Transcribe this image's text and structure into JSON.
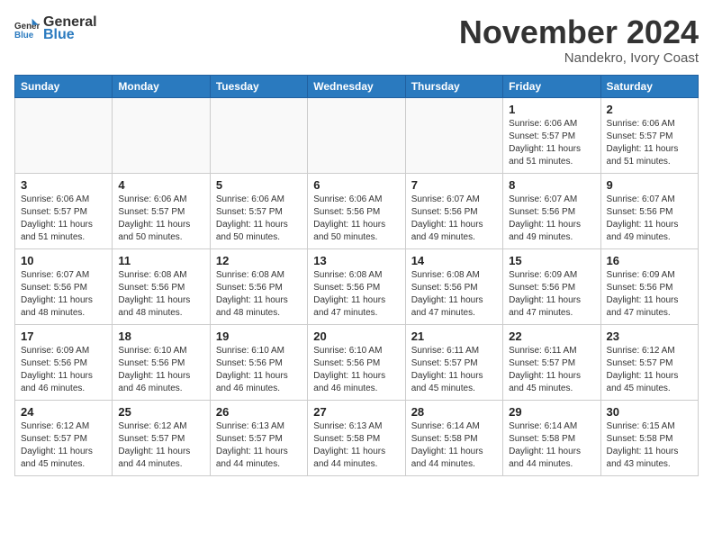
{
  "header": {
    "logo_line1": "General",
    "logo_line2": "Blue",
    "month_title": "November 2024",
    "location": "Nandekro, Ivory Coast"
  },
  "weekdays": [
    "Sunday",
    "Monday",
    "Tuesday",
    "Wednesday",
    "Thursday",
    "Friday",
    "Saturday"
  ],
  "weeks": [
    [
      {
        "day": "",
        "info": ""
      },
      {
        "day": "",
        "info": ""
      },
      {
        "day": "",
        "info": ""
      },
      {
        "day": "",
        "info": ""
      },
      {
        "day": "",
        "info": ""
      },
      {
        "day": "1",
        "info": "Sunrise: 6:06 AM\nSunset: 5:57 PM\nDaylight: 11 hours\nand 51 minutes."
      },
      {
        "day": "2",
        "info": "Sunrise: 6:06 AM\nSunset: 5:57 PM\nDaylight: 11 hours\nand 51 minutes."
      }
    ],
    [
      {
        "day": "3",
        "info": "Sunrise: 6:06 AM\nSunset: 5:57 PM\nDaylight: 11 hours\nand 51 minutes."
      },
      {
        "day": "4",
        "info": "Sunrise: 6:06 AM\nSunset: 5:57 PM\nDaylight: 11 hours\nand 50 minutes."
      },
      {
        "day": "5",
        "info": "Sunrise: 6:06 AM\nSunset: 5:57 PM\nDaylight: 11 hours\nand 50 minutes."
      },
      {
        "day": "6",
        "info": "Sunrise: 6:06 AM\nSunset: 5:56 PM\nDaylight: 11 hours\nand 50 minutes."
      },
      {
        "day": "7",
        "info": "Sunrise: 6:07 AM\nSunset: 5:56 PM\nDaylight: 11 hours\nand 49 minutes."
      },
      {
        "day": "8",
        "info": "Sunrise: 6:07 AM\nSunset: 5:56 PM\nDaylight: 11 hours\nand 49 minutes."
      },
      {
        "day": "9",
        "info": "Sunrise: 6:07 AM\nSunset: 5:56 PM\nDaylight: 11 hours\nand 49 minutes."
      }
    ],
    [
      {
        "day": "10",
        "info": "Sunrise: 6:07 AM\nSunset: 5:56 PM\nDaylight: 11 hours\nand 48 minutes."
      },
      {
        "day": "11",
        "info": "Sunrise: 6:08 AM\nSunset: 5:56 PM\nDaylight: 11 hours\nand 48 minutes."
      },
      {
        "day": "12",
        "info": "Sunrise: 6:08 AM\nSunset: 5:56 PM\nDaylight: 11 hours\nand 48 minutes."
      },
      {
        "day": "13",
        "info": "Sunrise: 6:08 AM\nSunset: 5:56 PM\nDaylight: 11 hours\nand 47 minutes."
      },
      {
        "day": "14",
        "info": "Sunrise: 6:08 AM\nSunset: 5:56 PM\nDaylight: 11 hours\nand 47 minutes."
      },
      {
        "day": "15",
        "info": "Sunrise: 6:09 AM\nSunset: 5:56 PM\nDaylight: 11 hours\nand 47 minutes."
      },
      {
        "day": "16",
        "info": "Sunrise: 6:09 AM\nSunset: 5:56 PM\nDaylight: 11 hours\nand 47 minutes."
      }
    ],
    [
      {
        "day": "17",
        "info": "Sunrise: 6:09 AM\nSunset: 5:56 PM\nDaylight: 11 hours\nand 46 minutes."
      },
      {
        "day": "18",
        "info": "Sunrise: 6:10 AM\nSunset: 5:56 PM\nDaylight: 11 hours\nand 46 minutes."
      },
      {
        "day": "19",
        "info": "Sunrise: 6:10 AM\nSunset: 5:56 PM\nDaylight: 11 hours\nand 46 minutes."
      },
      {
        "day": "20",
        "info": "Sunrise: 6:10 AM\nSunset: 5:56 PM\nDaylight: 11 hours\nand 46 minutes."
      },
      {
        "day": "21",
        "info": "Sunrise: 6:11 AM\nSunset: 5:57 PM\nDaylight: 11 hours\nand 45 minutes."
      },
      {
        "day": "22",
        "info": "Sunrise: 6:11 AM\nSunset: 5:57 PM\nDaylight: 11 hours\nand 45 minutes."
      },
      {
        "day": "23",
        "info": "Sunrise: 6:12 AM\nSunset: 5:57 PM\nDaylight: 11 hours\nand 45 minutes."
      }
    ],
    [
      {
        "day": "24",
        "info": "Sunrise: 6:12 AM\nSunset: 5:57 PM\nDaylight: 11 hours\nand 45 minutes."
      },
      {
        "day": "25",
        "info": "Sunrise: 6:12 AM\nSunset: 5:57 PM\nDaylight: 11 hours\nand 44 minutes."
      },
      {
        "day": "26",
        "info": "Sunrise: 6:13 AM\nSunset: 5:57 PM\nDaylight: 11 hours\nand 44 minutes."
      },
      {
        "day": "27",
        "info": "Sunrise: 6:13 AM\nSunset: 5:58 PM\nDaylight: 11 hours\nand 44 minutes."
      },
      {
        "day": "28",
        "info": "Sunrise: 6:14 AM\nSunset: 5:58 PM\nDaylight: 11 hours\nand 44 minutes."
      },
      {
        "day": "29",
        "info": "Sunrise: 6:14 AM\nSunset: 5:58 PM\nDaylight: 11 hours\nand 44 minutes."
      },
      {
        "day": "30",
        "info": "Sunrise: 6:15 AM\nSunset: 5:58 PM\nDaylight: 11 hours\nand 43 minutes."
      }
    ]
  ]
}
